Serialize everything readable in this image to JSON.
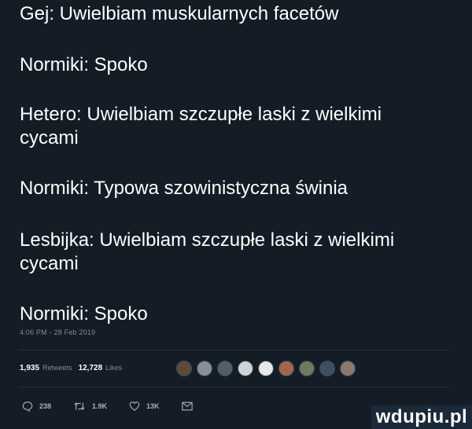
{
  "tweet": {
    "lines": [
      "Gej: Uwielbiam muskularnych facetów",
      "Normiki: Spoko",
      "Hetero: Uwielbiam szczupłe laski z wielkimi",
      "cycami",
      "Normiki: Typowa szowinistyczna świnia",
      "Lesbijka: Uwielbiam szczupłe laski z wielkimi",
      "cycami",
      "Normiki: Spoko"
    ],
    "timestamp": "4:06 PM - 28 Feb 2019"
  },
  "stats": {
    "retweets_count": "1,935",
    "retweets_label": "Retweets",
    "likes_count": "12,728",
    "likes_label": "Likes"
  },
  "avatars": [
    {
      "color": "#5d4a3a"
    },
    {
      "color": "#8a8f96"
    },
    {
      "color": "#4e5e6b"
    },
    {
      "color": "#cfd3d6"
    },
    {
      "color": "#e8e8e8"
    },
    {
      "color": "#a0674b"
    },
    {
      "color": "#6d7c5a"
    },
    {
      "color": "#3e4f63"
    },
    {
      "color": "#8b7a6b"
    }
  ],
  "actions": {
    "reply_count": "238",
    "retweet_count": "1.9K",
    "like_count": "13K",
    "reply_icon": "reply-icon",
    "retweet_icon": "retweet-icon",
    "like_icon": "heart-icon",
    "dm_icon": "envelope-icon"
  },
  "watermark": {
    "text": "wdupiu.pl"
  },
  "colors": {
    "background": "#141d26",
    "text": "#ffffff",
    "muted": "#7f8b96"
  }
}
